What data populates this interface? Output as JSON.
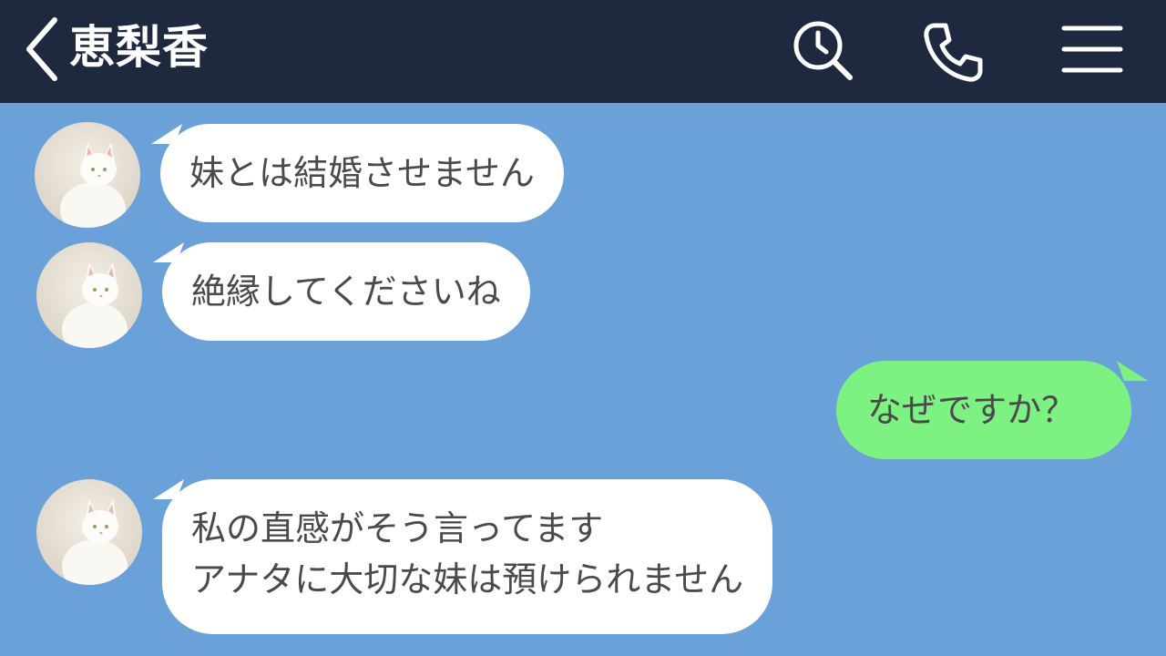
{
  "header": {
    "title": "恵梨香",
    "background": "#1e2940",
    "icons": [
      "chevron-left-icon",
      "search-clock-icon",
      "phone-icon",
      "menu-icon"
    ]
  },
  "chat": {
    "background": "#6aa1d9",
    "incoming_bubble_color": "#ffffff",
    "outgoing_bubble_color": "#7df283",
    "messages": [
      {
        "sender": "them",
        "lines": [
          "妹とは結婚させません"
        ]
      },
      {
        "sender": "them",
        "lines": [
          "絶縁してくださいね"
        ]
      },
      {
        "sender": "me",
        "lines": [
          "なぜですか？"
        ]
      },
      {
        "sender": "them",
        "lines": [
          "私の直感がそう言ってます",
          "アナタに大切な妹は預けられません"
        ]
      }
    ]
  }
}
